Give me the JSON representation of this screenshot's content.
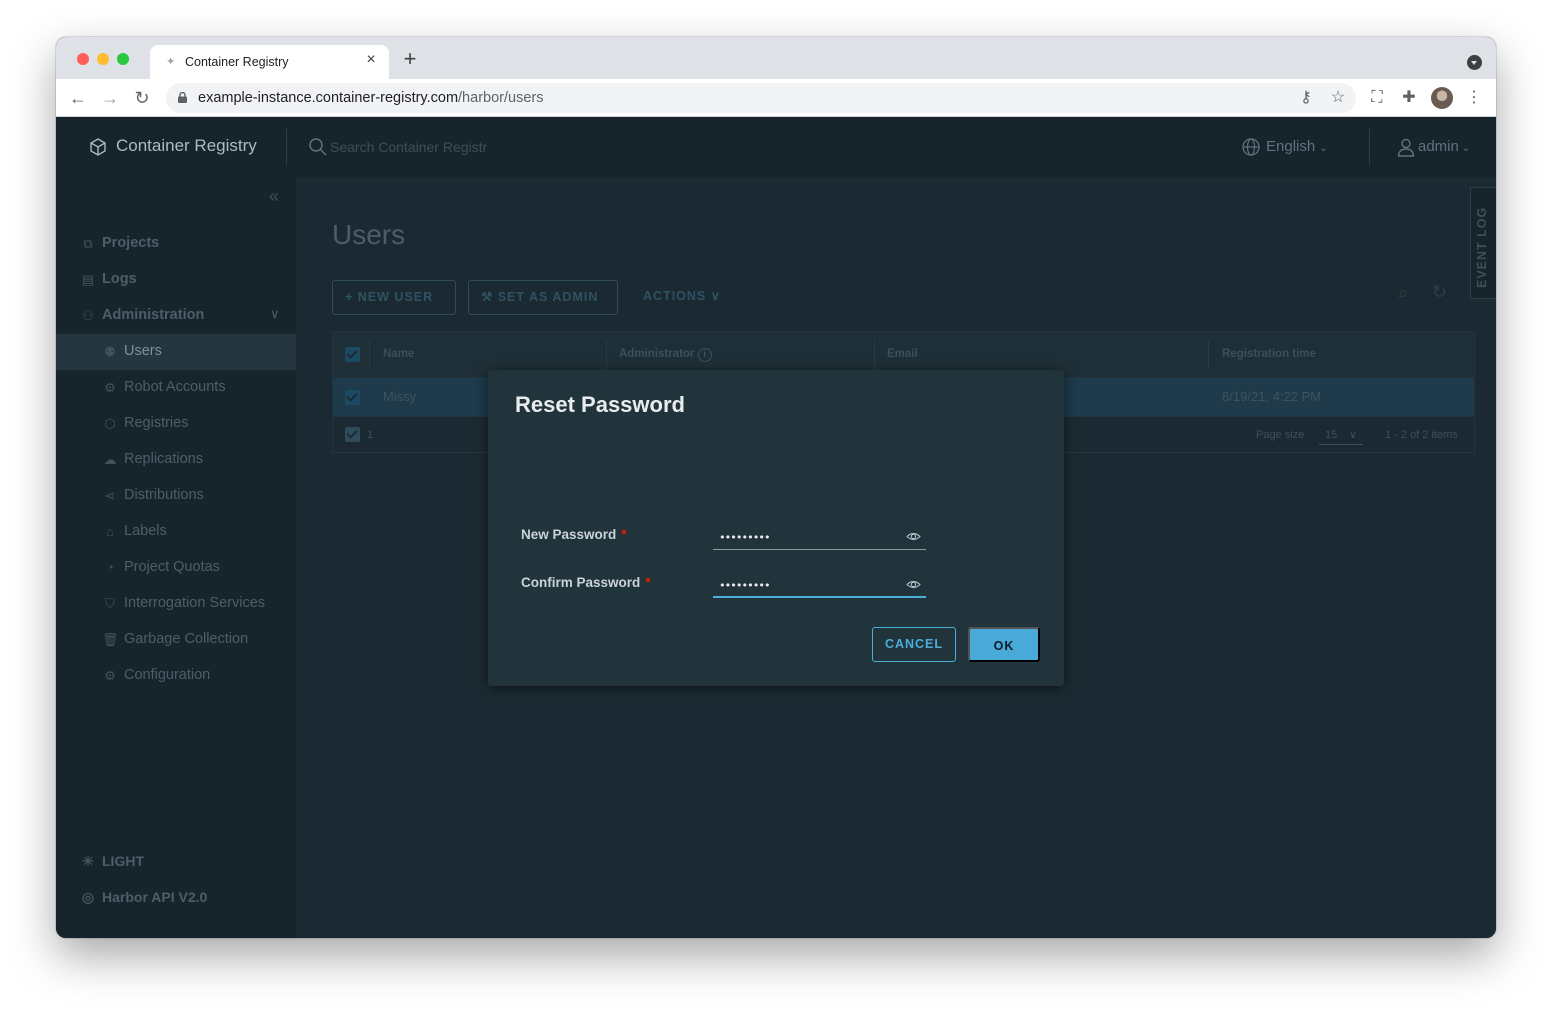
{
  "browser": {
    "tab_title": "Container Registry",
    "url_host": "example-instance.container-registry.com",
    "url_path": "/harbor/users"
  },
  "app": {
    "brand": "Container Registry",
    "search_placeholder": "Search Container Registr",
    "language": "English",
    "user": "admin"
  },
  "sidebar": {
    "items": [
      {
        "label": "Projects",
        "icon": "projects-icon"
      },
      {
        "label": "Logs",
        "icon": "logs-icon"
      },
      {
        "label": "Administration",
        "icon": "administration-icon",
        "expanded": true
      },
      {
        "label": "Users",
        "icon": "users-icon",
        "active": true
      },
      {
        "label": "Robot Accounts",
        "icon": "robot-icon"
      },
      {
        "label": "Registries",
        "icon": "registries-icon"
      },
      {
        "label": "Replications",
        "icon": "replications-icon"
      },
      {
        "label": "Distributions",
        "icon": "distributions-icon"
      },
      {
        "label": "Labels",
        "icon": "labels-icon"
      },
      {
        "label": "Project Quotas",
        "icon": "quotas-icon"
      },
      {
        "label": "Interrogation Services",
        "icon": "shield-icon"
      },
      {
        "label": "Garbage Collection",
        "icon": "trash-icon"
      },
      {
        "label": "Configuration",
        "icon": "gear-icon"
      }
    ],
    "theme_toggle": "LIGHT",
    "api_link": "Harbor API V2.0"
  },
  "main": {
    "title": "Users",
    "buttons": {
      "new_user": "NEW USER",
      "set_as_admin": "SET AS ADMIN",
      "actions": "ACTIONS"
    },
    "event_log": "EVENT LOG",
    "grid": {
      "columns": [
        "Name",
        "Administrator",
        "Email",
        "Registration time"
      ],
      "rows": [
        {
          "name": "Missy",
          "administrator": "",
          "email": "",
          "registration_time": "8/19/21, 4:22 PM",
          "selected": true
        }
      ],
      "footer": {
        "selected_count": "1",
        "page_size_label": "Page size",
        "page_size": "15",
        "items_summary": "1 - 2 of 2 items"
      }
    }
  },
  "modal": {
    "title": "Reset Password",
    "new_password_label": "New Password",
    "confirm_password_label": "Confirm Password",
    "required_marker": "*",
    "new_password_value": "•••••••••",
    "confirm_password_value": "•••••••••",
    "cancel_label": "CANCEL",
    "ok_label": "OK"
  },
  "colors": {
    "accent": "#49a9d9",
    "app_bg": "#1b2a32",
    "modal_bg": "#21333b",
    "required": "#e12200"
  }
}
